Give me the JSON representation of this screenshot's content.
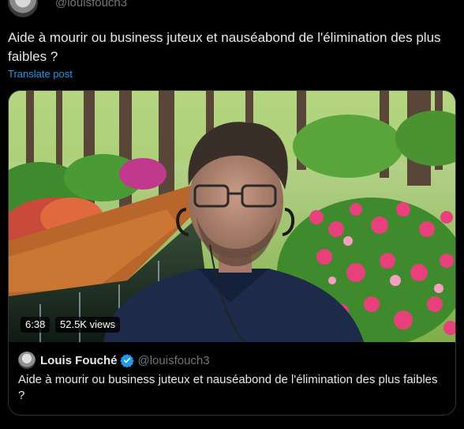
{
  "header": {
    "handle": "@louisfouch3"
  },
  "tweet": {
    "text": "Aide à mourir ou business juteux et nauséabond de l'élimination des plus faibles ?"
  },
  "translate_label": "Translate post",
  "video": {
    "duration": "6:38",
    "views": "52.5K views"
  },
  "quote": {
    "name": "Louis Fouché",
    "handle": "@louisfouch3",
    "text": "Aide à mourir ou business juteux et nauséabond de l'élimination des plus faibles ?"
  },
  "colors": {
    "background": "#000000",
    "text": "#e7e9ea",
    "muted": "#71767b",
    "link": "#1d9bf0",
    "border": "#2f3336",
    "verified": "#1d9bf0"
  }
}
